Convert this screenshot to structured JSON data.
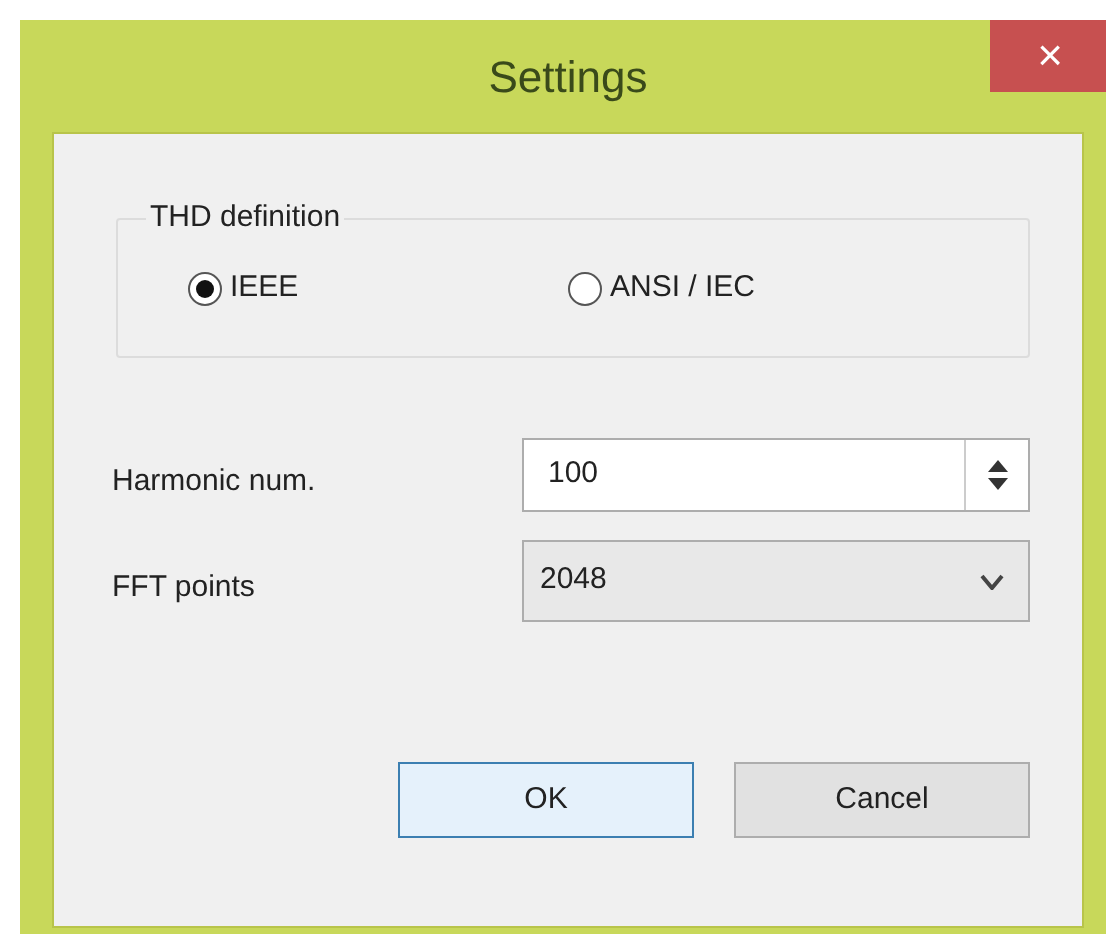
{
  "window": {
    "title": "Settings",
    "close": "×"
  },
  "thd_group": {
    "title": "THD definition",
    "options": [
      {
        "label": "IEEE",
        "selected": true
      },
      {
        "label": "ANSI / IEC",
        "selected": false
      }
    ]
  },
  "fields": [
    {
      "kind": "spin",
      "label": "Harmonic num.",
      "value": "100"
    },
    {
      "kind": "combo",
      "label": "FFT points",
      "value": "2048"
    }
  ],
  "buttons": [
    {
      "label": "OK",
      "default": true
    },
    {
      "label": "Cancel",
      "default": false
    }
  ]
}
